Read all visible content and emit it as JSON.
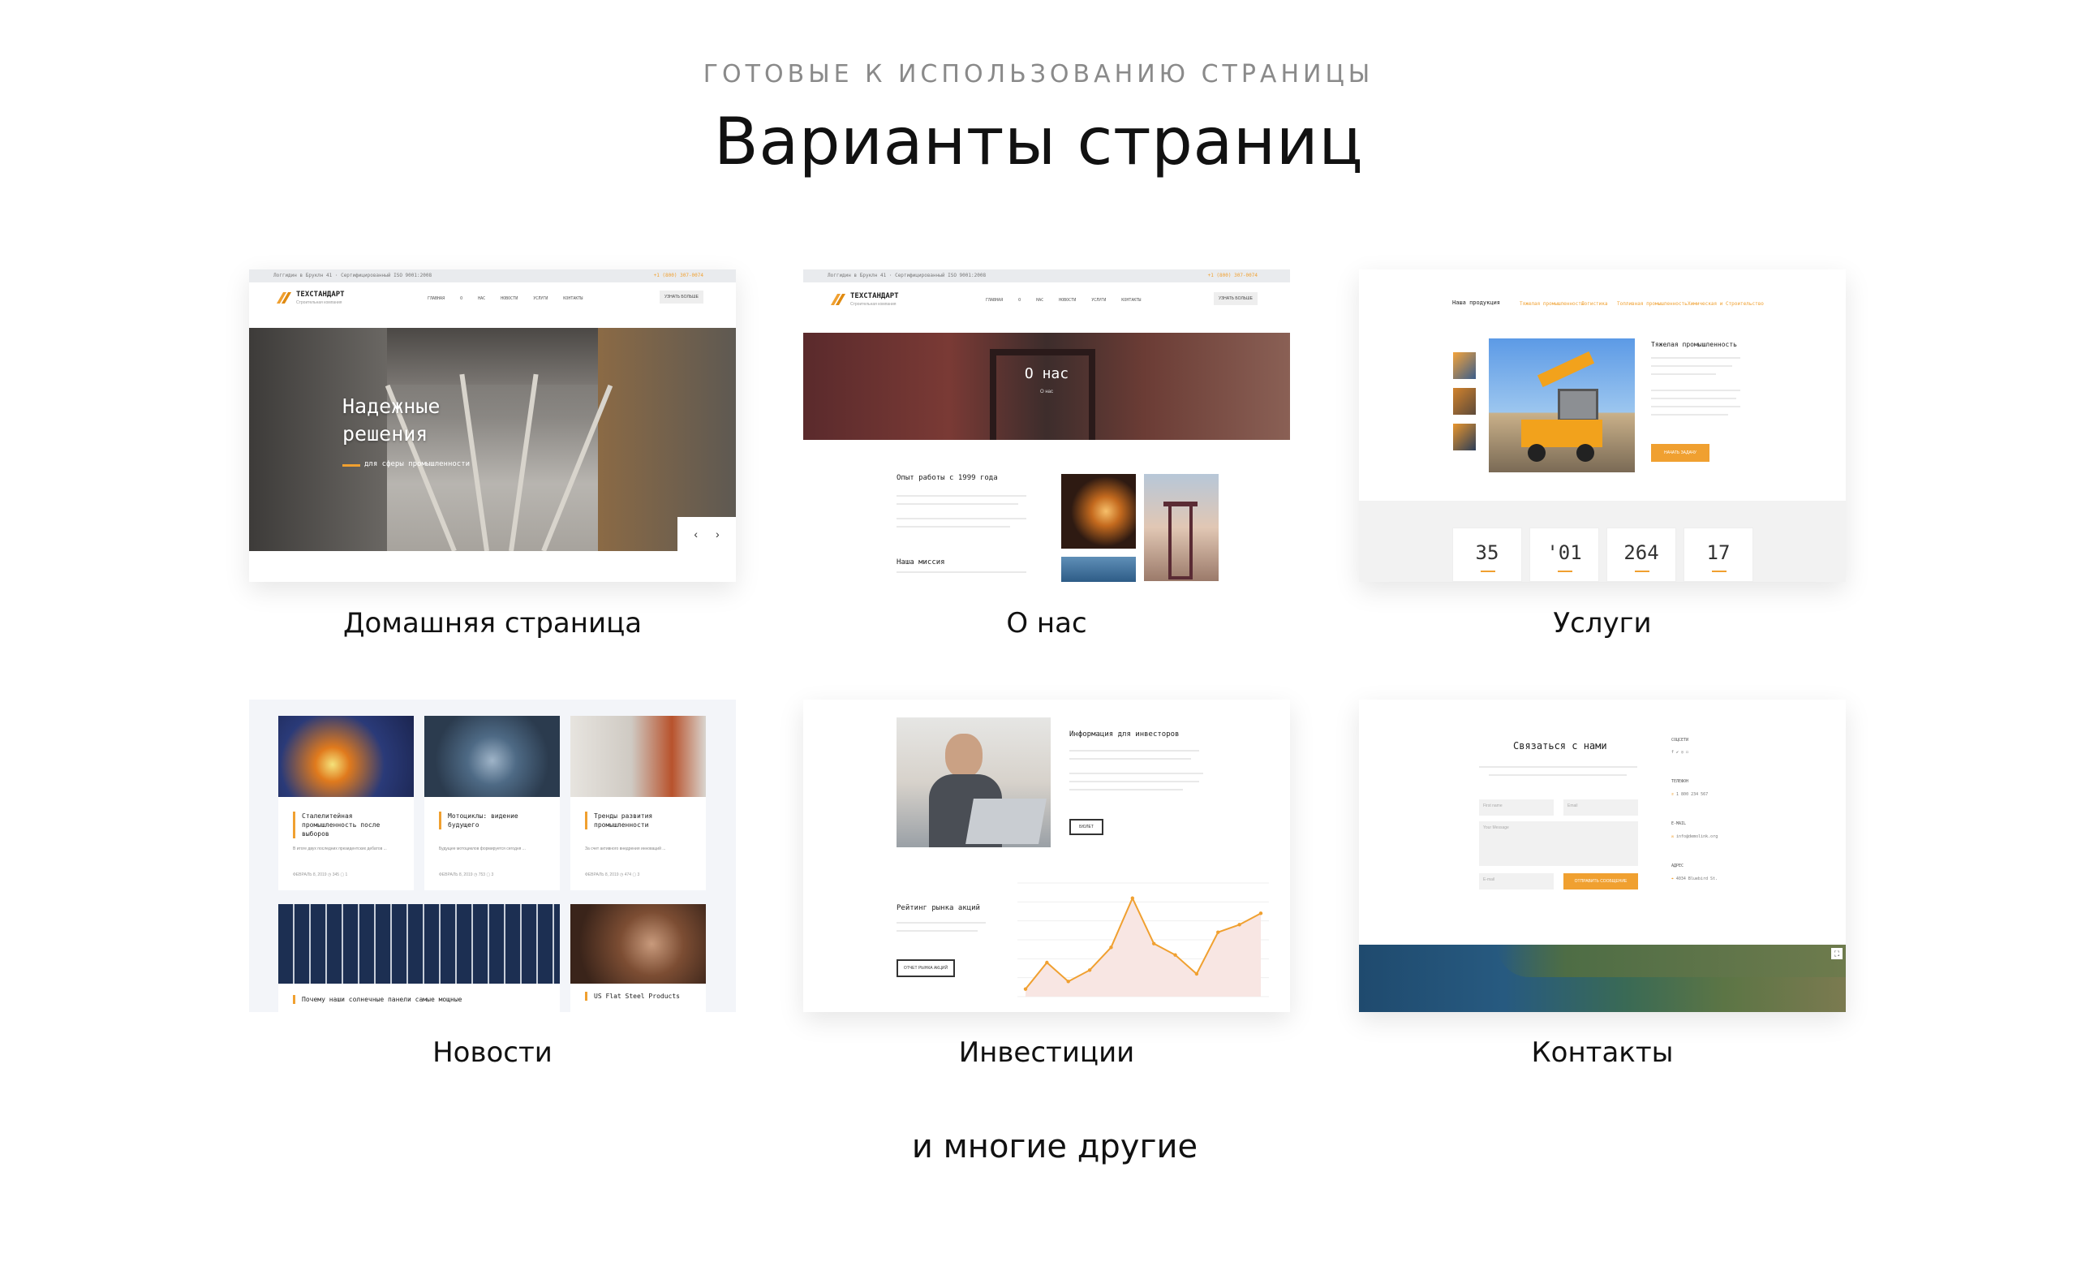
{
  "header": {
    "eyebrow": "ГОТОВЫЕ К ИСПОЛЬЗОВАНИЮ СТРАНИЦЫ",
    "title": "Варианты страниц"
  },
  "footer_text": "и многие другие",
  "colors": {
    "accent": "#f0a030",
    "text": "#111111",
    "muted": "#8a8a8a"
  },
  "cards": [
    {
      "caption": "Домашняя страница",
      "topbar_left": "Логгидин в Бруклн 41   ·   Сертифицированный ISO 9001:2008",
      "topbar_right": "+1 (800) 307-0074",
      "logo": "ТЕХСТАНДАРТ",
      "logo_sub": "Строительная компания",
      "nav": "ГЛАВНАЯ О НАС НОВОСТИ УСЛУГИ КОНТАКТЫ",
      "nav_button": "УЗНАТЬ БОЛЬШЕ",
      "hero_title_1": "Надежные",
      "hero_title_2": "решения",
      "hero_sub": "для сферы промышленности",
      "arrows": "‹ ›"
    },
    {
      "caption": "О нас",
      "topbar_left": "Логгидин в Бруклн 41   ·   Сертифицированный ISO 9001:2008",
      "topbar_right": "+1 (800) 307-0074",
      "logo": "ТЕХСТАНДАРТ",
      "logo_sub": "Строительная компания",
      "nav": "ГЛАВНАЯ О НАС НОВОСТИ УСЛУГИ КОНТАКТЫ",
      "nav_button": "УЗНАТЬ БОЛЬШЕ",
      "hero_title": "О нас",
      "hero_sub": "О нас",
      "heading_1": "Опыт работы с 1999 года",
      "heading_2": "Наша миссия"
    },
    {
      "caption": "Услуги",
      "tabs_title": "Наша продукция",
      "tabs": [
        "Тяжелая промышленность",
        "Логистика",
        "Топливная промышленность",
        "Химическая и Строительство"
      ],
      "product_title": "Тяжелая промышленность",
      "product_button": "НАЧАТЬ ЗАДАЧУ",
      "stats": [
        "35",
        "'01",
        "264",
        "17"
      ]
    },
    {
      "caption": "Новости",
      "news": [
        {
          "title": "Сталелитейная промышленность после выборов",
          "meta": "ФЕВРАЛЬ 8, 2019   ◷ 345   ▢ 1"
        },
        {
          "title": "Мотоциклы: видение будущего",
          "meta": "ФЕВРАЛЬ 8, 2019   ◷ 753   ▢ 3"
        },
        {
          "title": "Тренды развития промышленности",
          "meta": "ФЕВРАЛЬ 8, 2019   ◷ 474   ▢ 3"
        },
        {
          "title": "Почему наши солнечные панели самые мощные",
          "meta": ""
        },
        {
          "title": "US Flat Steel Products",
          "meta": ""
        }
      ]
    },
    {
      "caption": "Инвестиции",
      "heading_1": "Информация для инвесторов",
      "button_1": "БЮЛЕТ",
      "heading_2": "Рейтинг рынка акций",
      "button_2": "ОТЧЕТ РЫНКА АКЦИЙ",
      "chart_points": [
        4,
        18,
        8,
        14,
        26,
        52,
        28,
        22,
        12,
        34,
        38,
        44
      ]
    },
    {
      "caption": "Контакты",
      "heading": "Связаться с нами",
      "field_name": "First name",
      "field_last": "Email",
      "field_message": "Your Message",
      "field_email": "E-mail",
      "button": "ОТПРАВИТЬ СООБЩЕНИЕ",
      "side_social": "СОЦСЕТИ",
      "side_phone": "ТЕЛЕФОН",
      "side_email": "E-MAIL",
      "side_address": "АДРЕС"
    }
  ]
}
